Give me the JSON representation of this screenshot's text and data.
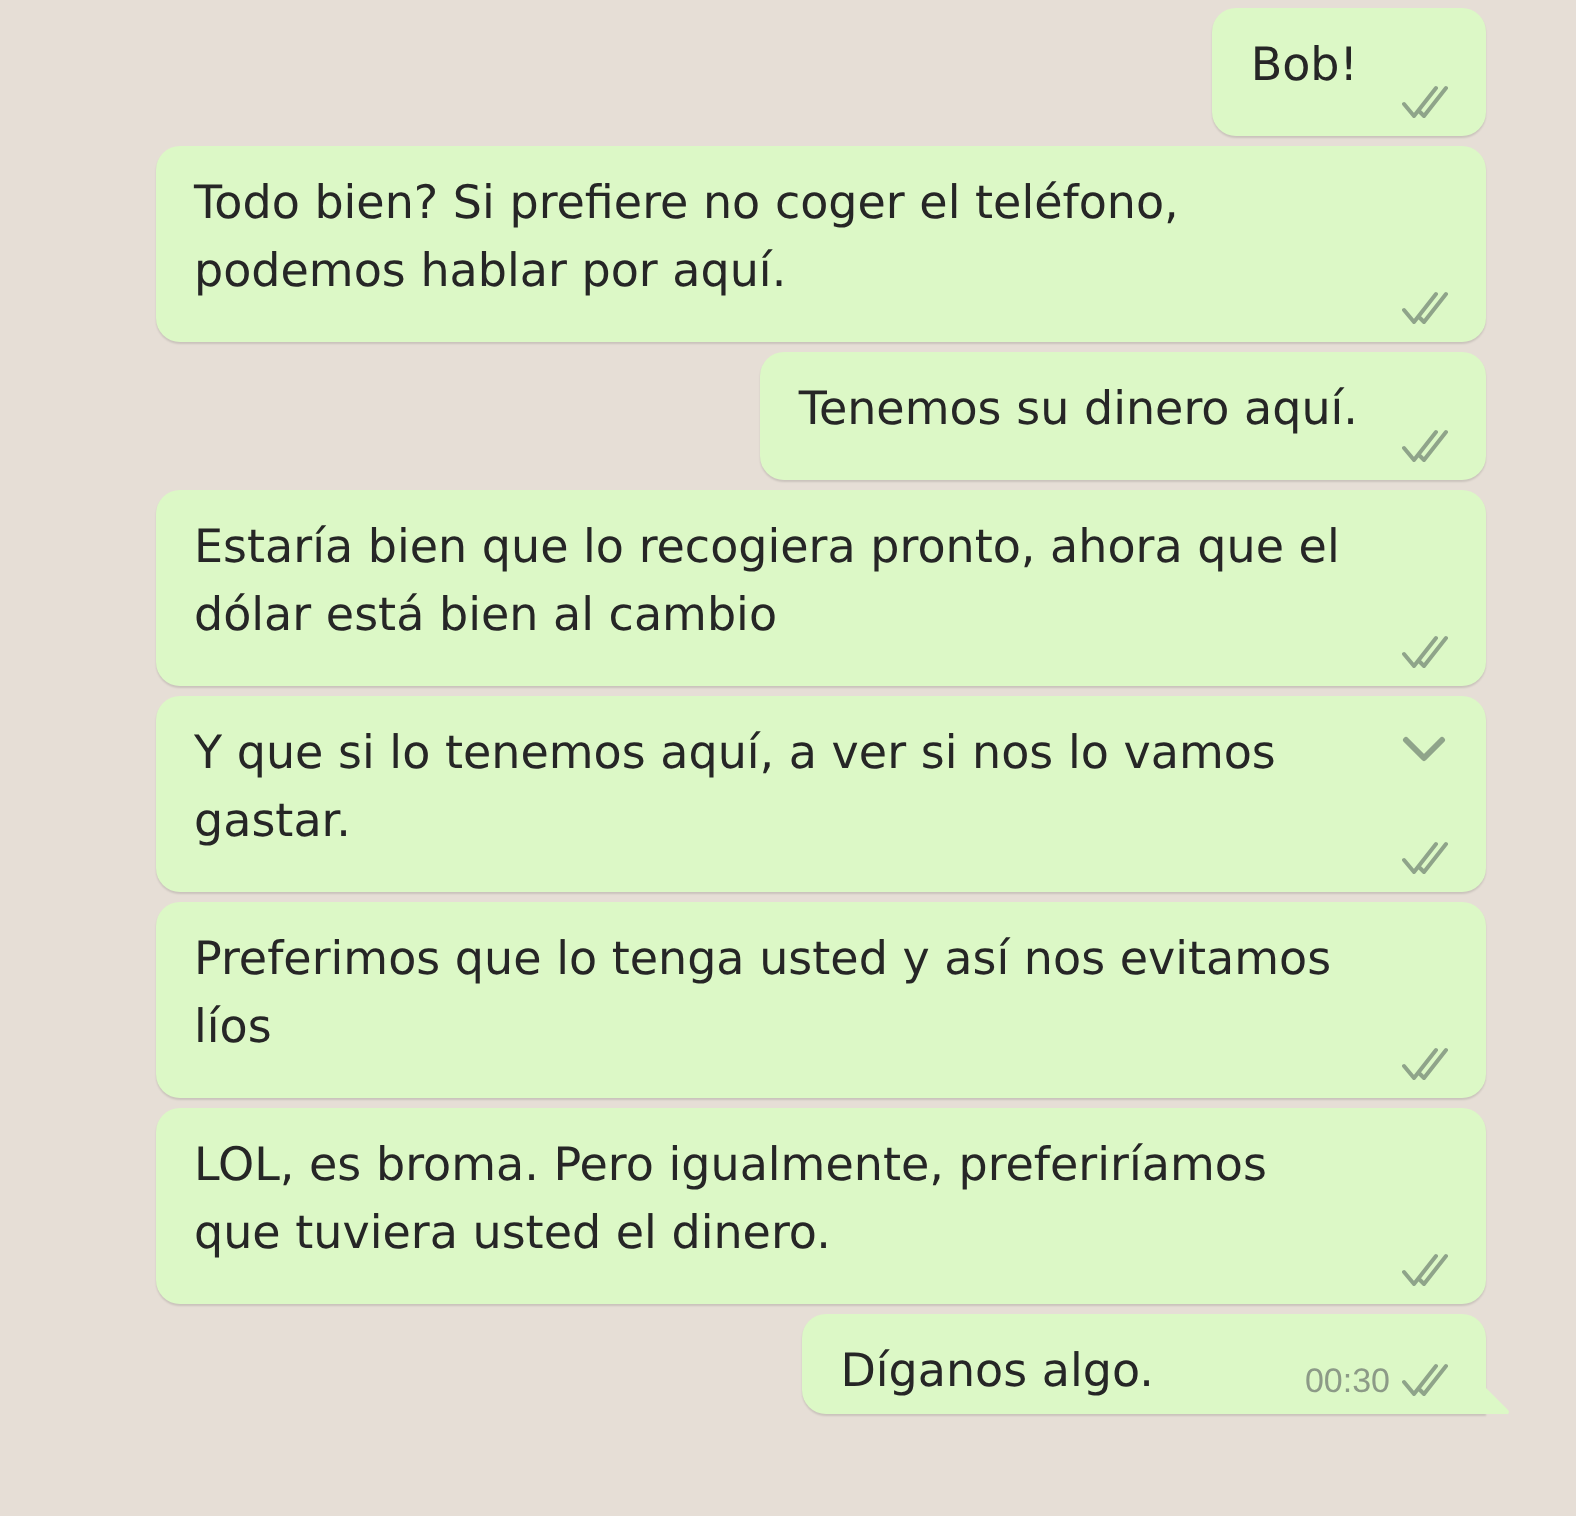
{
  "messages": [
    {
      "text": "Bob!",
      "read": false,
      "show_menu": false,
      "tail": false
    },
    {
      "text": "Todo bien? Si prefiere no coger el teléfono, podemos hablar por aquí.",
      "read": false,
      "show_menu": false,
      "tail": false
    },
    {
      "text": "Tenemos su dinero aquí.",
      "read": false,
      "show_menu": false,
      "tail": false
    },
    {
      "text": "Estaría bien que lo recogiera pronto, ahora que el dólar está bien al cambio",
      "read": false,
      "show_menu": false,
      "tail": false
    },
    {
      "text": "Y que si lo tenemos aquí, a ver si nos lo vamos gastar.",
      "read": false,
      "show_menu": true,
      "tail": false
    },
    {
      "text": "Preferimos que lo tenga usted y así nos evitamos líos",
      "read": false,
      "show_menu": false,
      "tail": false
    },
    {
      "text": "LOL, es broma. Pero igualmente, preferiríamos que tuviera usted el dinero.",
      "read": false,
      "show_menu": false,
      "tail": false
    },
    {
      "text": "Díganos algo.",
      "time": "00:30",
      "read": false,
      "show_menu": false,
      "tail": true
    }
  ]
}
